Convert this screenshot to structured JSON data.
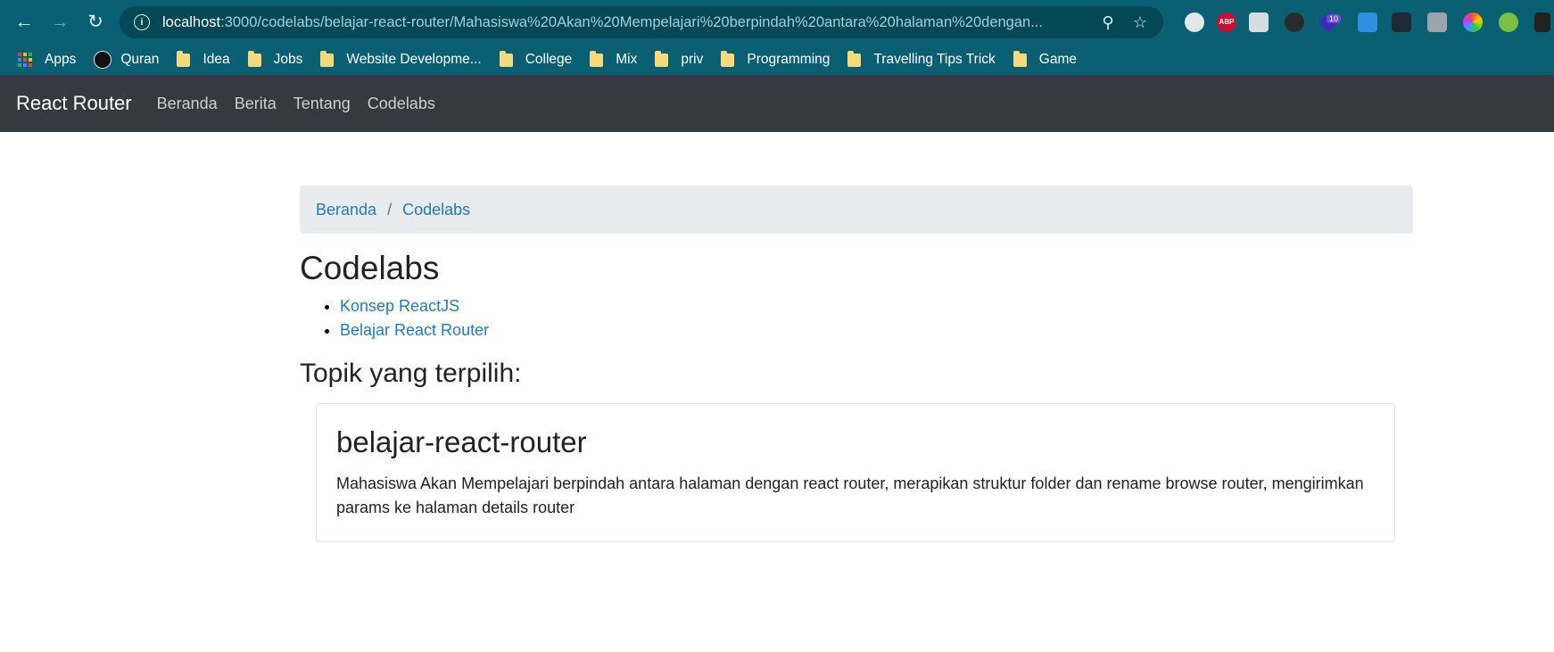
{
  "browser": {
    "url_host": "localhost",
    "url_rest": ":3000/codelabs/belajar-react-router/Mahasiswa%20Akan%20Mempelajari%20berpindah%20antara%20halaman%20dengan...",
    "extension_badge": "10",
    "extension_abp": "ABP",
    "bookmarks": [
      {
        "label": "Apps",
        "icon": "apps-icon"
      },
      {
        "label": "Quran",
        "icon": "quran-icon"
      },
      {
        "label": "Idea",
        "icon": "folder-icon"
      },
      {
        "label": "Jobs",
        "icon": "folder-icon"
      },
      {
        "label": "Website Developme...",
        "icon": "folder-icon"
      },
      {
        "label": "College",
        "icon": "folder-icon"
      },
      {
        "label": "Mix",
        "icon": "folder-icon"
      },
      {
        "label": "priv",
        "icon": "folder-icon"
      },
      {
        "label": "Programming",
        "icon": "folder-icon"
      },
      {
        "label": "Travelling Tips Trick",
        "icon": "folder-icon"
      },
      {
        "label": "Game",
        "icon": "folder-icon"
      }
    ],
    "chrome_color": "#0b5f73"
  },
  "navbar": {
    "brand": "React Router",
    "links": [
      "Beranda",
      "Berita",
      "Tentang",
      "Codelabs"
    ],
    "background": "#343a40"
  },
  "breadcrumb": {
    "items": [
      "Beranda",
      "Codelabs"
    ],
    "separator": "/"
  },
  "page": {
    "title": "Codelabs",
    "topics": [
      "Konsep ReactJS",
      "Belajar React Router"
    ],
    "selected_heading": "Topik yang terpilih:"
  },
  "card": {
    "title": "belajar-react-router",
    "text": "Mahasiswa Akan Mempelajari berpindah antara halaman dengan react router, merapikan struktur folder dan rename browse router, mengirimkan params ke halaman details router"
  },
  "colors": {
    "link": "#1f7ac1",
    "breadcrumb_bg": "#e9ecef"
  }
}
